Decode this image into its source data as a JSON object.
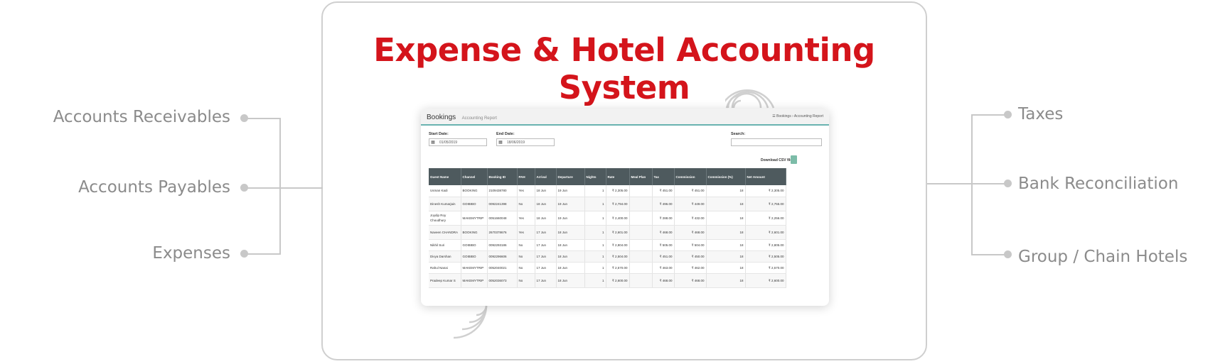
{
  "headline": "Expense & Hotel Accounting System",
  "left_items": [
    "Accounts Receivables",
    "Accounts Payables",
    "Expenses"
  ],
  "right_items": [
    "Taxes",
    "Bank Reconciliation",
    "Group / Chain Hotels"
  ],
  "colors": {
    "headline": "#d4141b",
    "connector": "#c8c8c8",
    "table_header": "#4e5a5e",
    "accent": "#69b3b0"
  },
  "screen": {
    "title": "Bookings",
    "subtitle": "Accounting Report",
    "breadcrumb": "☰ Bookings › Accounting Report",
    "start_date_label": "Start Date:",
    "start_date_value": "01/05/2019",
    "end_date_label": "End Date:",
    "end_date_value": "18/06/2019",
    "search_label": "Search:",
    "search_value": "",
    "download_label": "Download CSV file",
    "columns": [
      "Guest Name",
      "Channel",
      "Booking ID",
      "PAH",
      "Arrival",
      "Departure",
      "Nights",
      "Rate",
      "Meal Plan",
      "Tax",
      "Commission",
      "Commission (%)",
      "Net Amount"
    ],
    "rows": [
      [
        "Usman Kadi",
        "BOOKING",
        "2109438780",
        "Yes",
        "18 Jun",
        "19 Jun",
        "1",
        "₹ 2,305.00",
        "",
        "₹ 451.00",
        "₹ 451.00",
        "18",
        "₹ 2,305.00"
      ],
      [
        "Dinesh Kumarjain",
        "GOIBIBO",
        "0092241398",
        "No",
        "18 Jun",
        "19 Jun",
        "1",
        "₹ 2,794.00",
        "",
        "₹ 496.00",
        "₹ 449.00",
        "18",
        "₹ 2,755.00"
      ],
      [
        "Joydip Roy Choudhury",
        "MAKEMYTRIP",
        "0051660048",
        "Yes",
        "18 Jun",
        "19 Jun",
        "1",
        "₹ 2,400.00",
        "",
        "₹ 288.00",
        "₹ 432.00",
        "18",
        "₹ 2,256.00"
      ],
      [
        "Naveen CHANDRA",
        "BOOKING",
        "2670378676",
        "Yes",
        "17 Jun",
        "18 Jun",
        "1",
        "₹ 2,601.00",
        "",
        "₹ 468.00",
        "₹ 468.00",
        "18",
        "₹ 2,601.00"
      ],
      [
        "Nikhil Suri",
        "GOIBIBO",
        "0092293186",
        "No",
        "17 Jun",
        "18 Jun",
        "1",
        "₹ 2,804.00",
        "",
        "₹ 505.00",
        "₹ 504.00",
        "18",
        "₹ 2,805.00"
      ],
      [
        "Divya Darshan",
        "GOIBIBO",
        "0092296606",
        "No",
        "17 Jun",
        "18 Jun",
        "1",
        "₹ 2,504.00",
        "",
        "₹ 451.00",
        "₹ 450.00",
        "18",
        "₹ 2,505.00"
      ],
      [
        "Rahul Nanai",
        "MAKEMYTRIP",
        "0052040021",
        "No",
        "17 Jun",
        "18 Jun",
        "1",
        "₹ 2,570.00",
        "",
        "₹ 463.00",
        "₹ 462.00",
        "18",
        "₹ 2,570.00"
      ],
      [
        "Pradeep Kumar S",
        "MAKEMYTRIP",
        "0052036073",
        "No",
        "17 Jun",
        "18 Jun",
        "1",
        "₹ 2,600.00",
        "",
        "₹ 468.00",
        "₹ 468.00",
        "18",
        "₹ 2,600.00"
      ]
    ]
  }
}
